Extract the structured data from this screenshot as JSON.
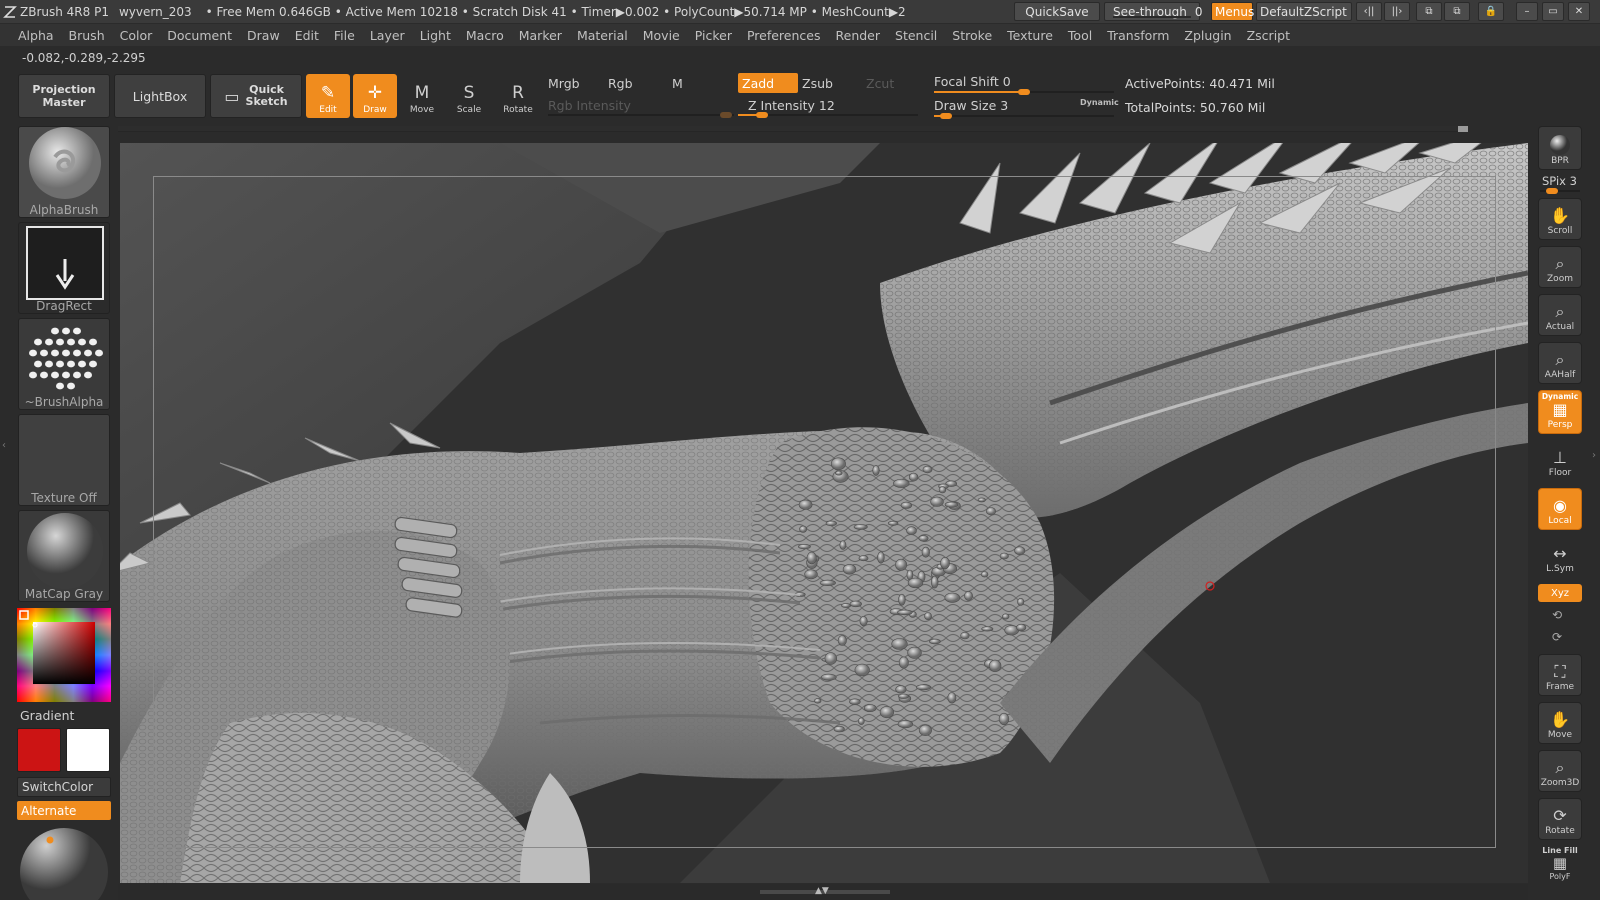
{
  "titlebar": {
    "app": "ZBrush 4R8 P1",
    "document": "wyvern_203",
    "status": "• Free Mem 0.646GB • Active Mem 10218 • Scratch Disk 41 • Timer▶0.002 • PolyCount▶50.714 MP • MeshCount▶2",
    "quicksave": "QuickSave",
    "see_through_label": "See-through",
    "see_through_value": "0",
    "menus": "Menus",
    "default_zscript": "DefaultZScript"
  },
  "menu": [
    "Alpha",
    "Brush",
    "Color",
    "Document",
    "Draw",
    "Edit",
    "File",
    "Layer",
    "Light",
    "Macro",
    "Marker",
    "Material",
    "Movie",
    "Picker",
    "Preferences",
    "Render",
    "Stencil",
    "Stroke",
    "Texture",
    "Tool",
    "Transform",
    "Zplugin",
    "Zscript"
  ],
  "coords": "-0.082,-0.289,-2.295",
  "shelf": {
    "projection_master_1": "Projection",
    "projection_master_2": "Master",
    "lightbox": "LightBox",
    "quick_sketch_1": "Quick",
    "quick_sketch_2": "Sketch",
    "tools": [
      {
        "label": "Edit",
        "glyph": "✎"
      },
      {
        "label": "Draw",
        "glyph": "✛"
      },
      {
        "label": "Move",
        "glyph": "M"
      },
      {
        "label": "Scale",
        "glyph": "S"
      },
      {
        "label": "Rotate",
        "glyph": "R"
      }
    ],
    "mrgb": "Mrgb",
    "rgb": "Rgb",
    "m": "M",
    "rgb_intensity": "Rgb Intensity",
    "zadd": "Zadd",
    "zsub": "Zsub",
    "zcut": "Zcut",
    "z_intensity": "Z Intensity 12",
    "focal_shift": "Focal Shift 0",
    "draw_size": "Draw Size 3",
    "dynamic": "Dynamic",
    "active_points": "ActivePoints: 40.471 Mil",
    "total_points": "TotalPoints: 50.760 Mil",
    "z_intensity_value": 12,
    "draw_size_value": 3,
    "focal_shift_value": 0
  },
  "left_tray": {
    "alpha_brush": "AlphaBrush",
    "drag_rect": "DragRect",
    "brush_alpha": "~BrushAlpha",
    "texture_off": "Texture Off",
    "matcap_gray": "MatCap Gray",
    "gradient": "Gradient",
    "switch_color": "SwitchColor",
    "alternate": "Alternate",
    "main_color": "#cc1414",
    "secondary_color": "#ffffff"
  },
  "right_shelf": {
    "bpr": "BPR",
    "spix": "SPix 3",
    "buttons": [
      {
        "label": "Scroll",
        "glyph": "✋",
        "active": false
      },
      {
        "label": "Zoom",
        "glyph": "⌕",
        "active": false
      },
      {
        "label": "Actual",
        "glyph": "⌕",
        "active": false
      },
      {
        "label": "AAHalf",
        "glyph": "⌕",
        "active": false
      },
      {
        "label": "Persp",
        "glyph": "▦",
        "active": true
      },
      {
        "label": "Floor",
        "glyph": "⊥",
        "active": false
      },
      {
        "label": "Local",
        "glyph": "◉",
        "active": true
      },
      {
        "label": "L.Sym",
        "glyph": "↔",
        "active": false
      },
      {
        "label": "Frame",
        "glyph": "⛶",
        "active": false
      },
      {
        "label": "Move",
        "glyph": "✋",
        "active": false
      },
      {
        "label": "Zoom3D",
        "glyph": "⌕",
        "active": false
      },
      {
        "label": "Rotate",
        "glyph": "⟳",
        "active": false
      }
    ],
    "dynamic": "Dynamic",
    "xyz": "Xyz",
    "line_fill": "Line Fill",
    "polyf": "PolyF"
  }
}
